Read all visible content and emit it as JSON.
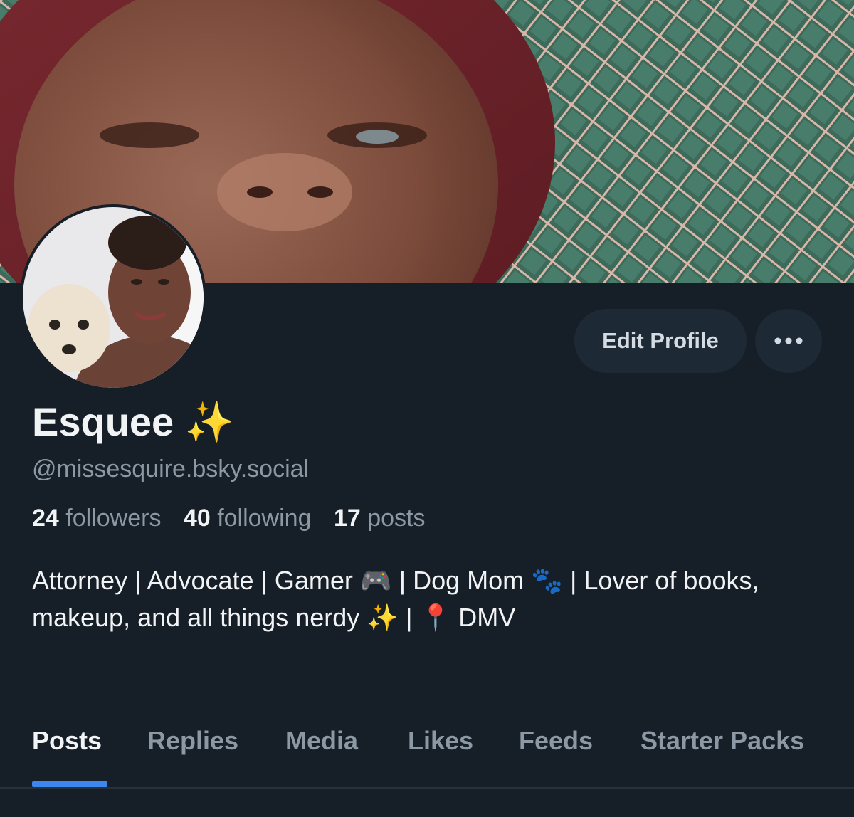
{
  "profile": {
    "display_name": "Esquee ✨",
    "handle": "@missesquire.bsky.social",
    "bio": "Attorney | Advocate | Gamer 🎮 | Dog Mom 🐾 | Lover of books, makeup, and all things nerdy ✨ | 📍 DMV"
  },
  "stats": {
    "followers_count": "24",
    "followers_label": "followers",
    "following_count": "40",
    "following_label": "following",
    "posts_count": "17",
    "posts_label": "posts"
  },
  "actions": {
    "edit_profile_label": "Edit Profile",
    "more_icon": "ellipsis-icon"
  },
  "tabs": [
    {
      "label": "Posts",
      "active": true
    },
    {
      "label": "Replies",
      "active": false
    },
    {
      "label": "Media",
      "active": false
    },
    {
      "label": "Likes",
      "active": false
    },
    {
      "label": "Feeds",
      "active": false
    },
    {
      "label": "Starter Packs",
      "active": false
    }
  ],
  "colors": {
    "background": "#161e27",
    "accent": "#3c86f0",
    "muted_text": "#8d98a5",
    "button_bg": "#1e2936"
  }
}
